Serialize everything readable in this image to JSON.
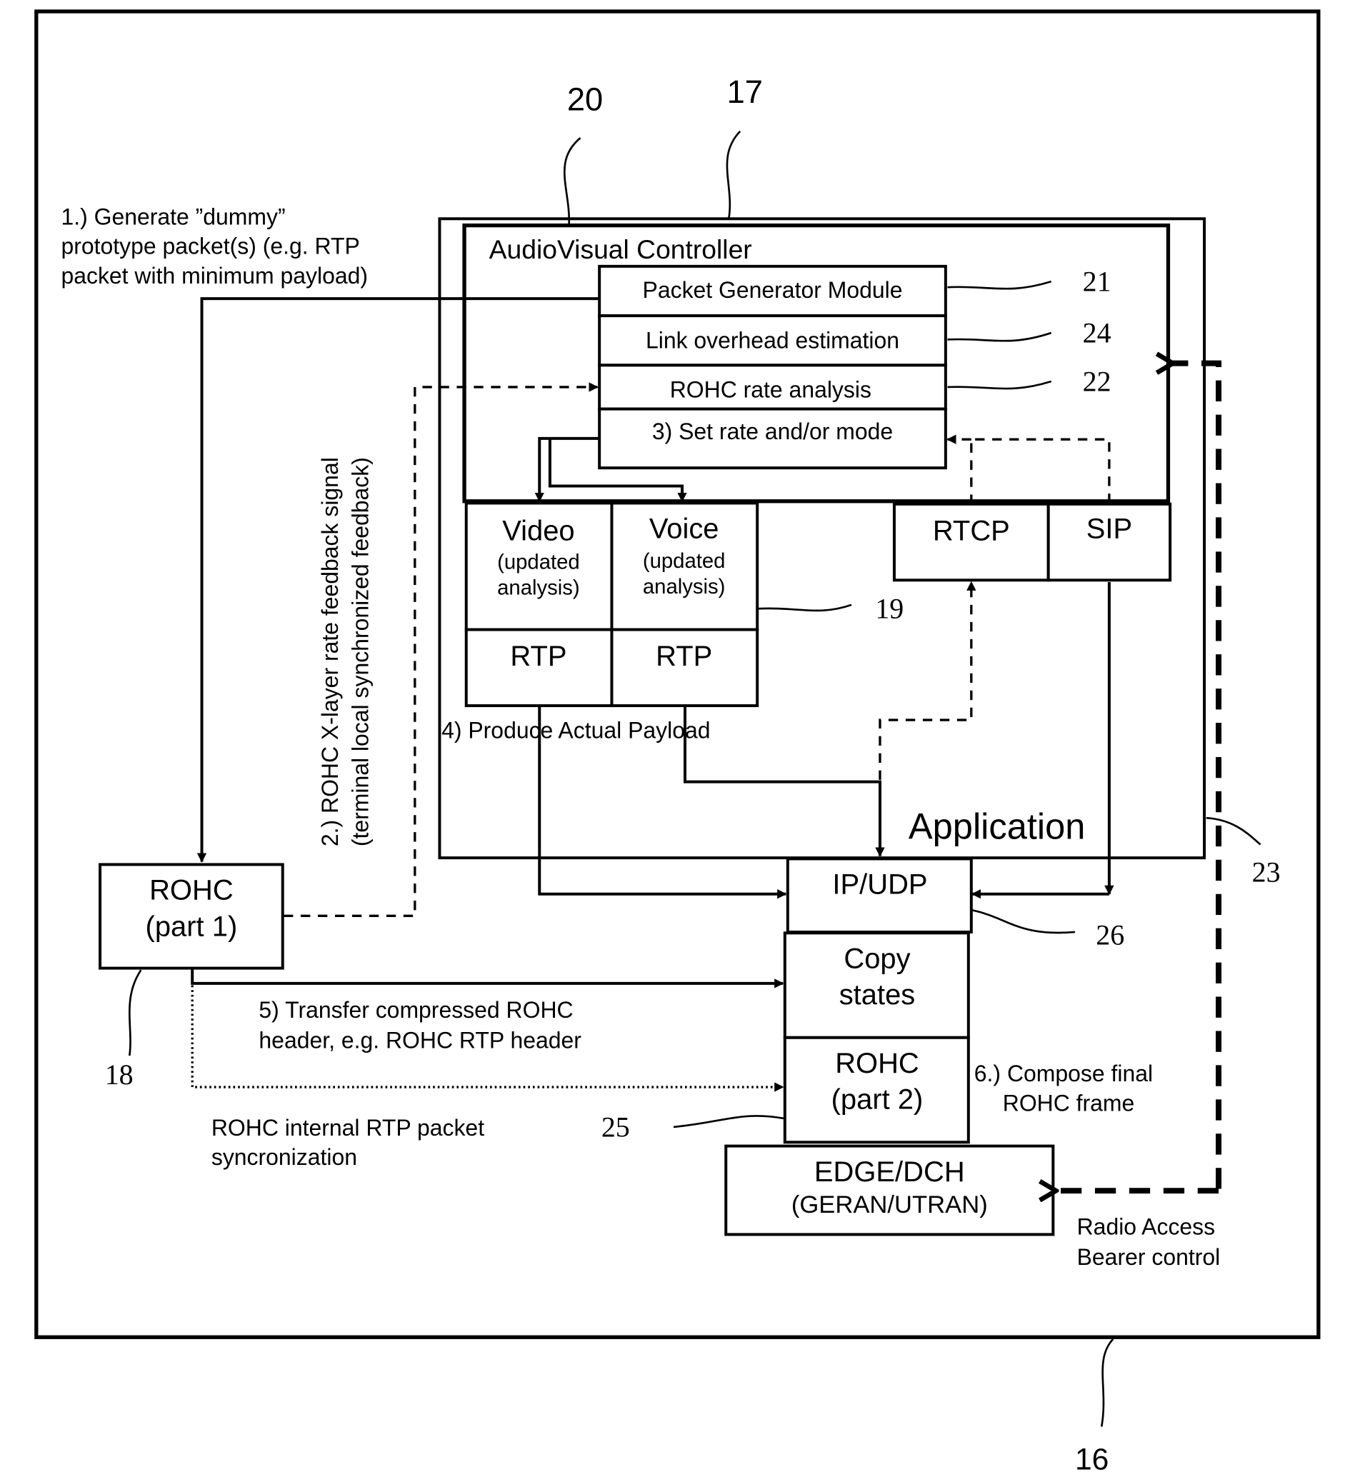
{
  "figure": {
    "ref_numbers": {
      "r16": "16",
      "r17": "17",
      "r18": "18",
      "r19": "19",
      "r20": "20",
      "r21": "21",
      "r22": "22",
      "r23": "23",
      "r24": "24",
      "r25": "25",
      "r26": "26"
    },
    "step1": [
      "1.) Generate ”dummy”",
      "prototype packet(s) (e.g. RTP",
      "packet with minimum payload)"
    ],
    "step2": [
      "2.) ROHC X-layer rate feedback signal",
      "(terminal local synchronized feedback)"
    ],
    "av_controller": "AudioVisual Controller",
    "modules": [
      "Packet Generator Module",
      "Link overhead estimation",
      "ROHC rate analysis",
      "3) Set rate and/or mode"
    ],
    "video": {
      "title": "Video",
      "sub1": "(updated",
      "sub2": "analysis)",
      "rtp": "RTP"
    },
    "voice": {
      "title": "Voice",
      "sub1": "(updated",
      "sub2": "analysis)",
      "rtp": "RTP"
    },
    "rtcp": "RTCP",
    "sip": "SIP",
    "step4": "4)  Produce Actual Payload",
    "application": "Application",
    "rohc1": [
      "ROHC",
      "(part 1)"
    ],
    "ipudp": "IP/UDP",
    "copy_states": [
      "Copy",
      "states"
    ],
    "rohc2": [
      "ROHC",
      "(part 2)"
    ],
    "edge": [
      "EDGE/DCH",
      "(GERAN/UTRAN)"
    ],
    "step5": [
      "5) Transfer compressed ROHC",
      "header, e.g. ROHC RTP header"
    ],
    "sync": [
      "ROHC internal RTP packet",
      "syncronization"
    ],
    "step6": [
      "6.) Compose final",
      "ROHC frame"
    ],
    "rab": [
      "Radio Access",
      "Bearer control"
    ]
  }
}
